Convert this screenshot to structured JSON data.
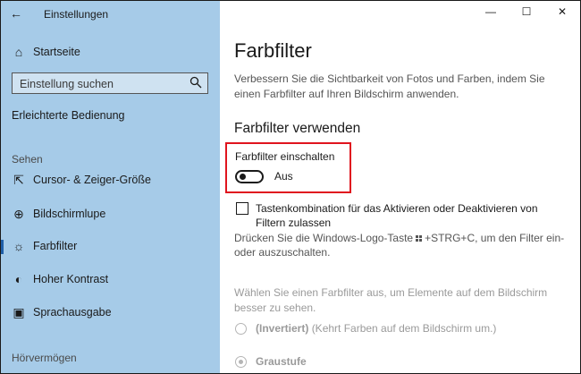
{
  "window": {
    "title": "Einstellungen",
    "controls": {
      "minimize": "—",
      "maximize": "☐",
      "close": "✕"
    }
  },
  "sidebar": {
    "home_label": "Startseite",
    "search_placeholder": "Einstellung suchen",
    "section_title": "Erleichterte Bedienung",
    "group_vision": "Sehen",
    "items": [
      {
        "label": "Cursor- & Zeiger-Größe",
        "icon": "cursor-icon",
        "active": false
      },
      {
        "label": "Bildschirmlupe",
        "icon": "magnifier-icon",
        "active": false
      },
      {
        "label": "Farbfilter",
        "icon": "sun-icon",
        "active": true
      },
      {
        "label": "Hoher Kontrast",
        "icon": "contrast-icon",
        "active": false
      },
      {
        "label": "Sprachausgabe",
        "icon": "narrator-icon",
        "active": false
      }
    ],
    "group_hearing": "Hörvermögen"
  },
  "main": {
    "title": "Farbfilter",
    "description": "Verbessern Sie die Sichtbarkeit von Fotos und Farben, indem Sie einen Farbfilter auf Ihren Bildschirm anwenden.",
    "section_heading": "Farbfilter verwenden",
    "toggle": {
      "label": "Farbfilter einschalten",
      "state": "Aus",
      "on": false
    },
    "shortcut_checkbox": {
      "label": "Tastenkombination für das Aktivieren oder Deaktivieren von Filtern zulassen",
      "checked": false,
      "hint_before": "Drücken Sie die Windows-Logo-Taste",
      "hint_after": "+STRG+C, um den Filter ein- oder auszuschalten."
    },
    "choose_text": "Wählen Sie einen Farbfilter aus, um Elemente auf dem Bildschirm besser zu sehen.",
    "filters": [
      {
        "name": "(Invertiert)",
        "note": "(Kehrt Farben auf dem Bildschirm um.)",
        "selected": false
      },
      {
        "name": "Graustufe",
        "note": "",
        "selected": true
      }
    ]
  },
  "colors": {
    "sidebar_bg": "#a6cbe8",
    "highlight_box": "#e0141e",
    "accent": "#1f5fa8"
  }
}
